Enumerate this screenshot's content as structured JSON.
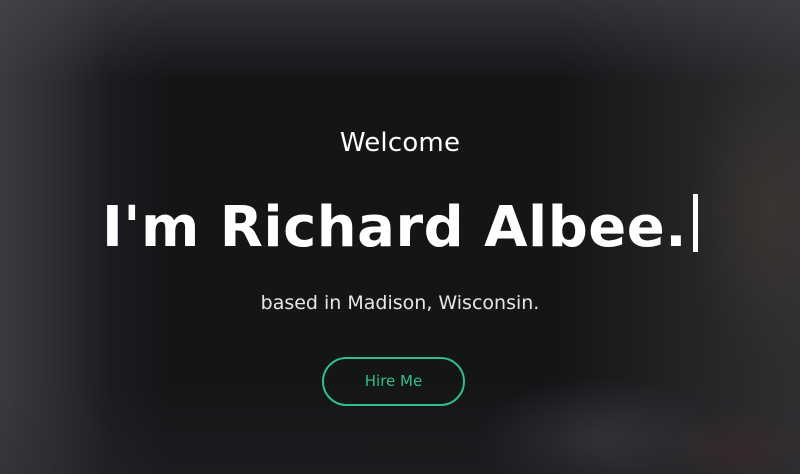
{
  "hero": {
    "welcome": "Welcome",
    "headline": "I'm Richard Albee.",
    "subtitle": "based in Madison, Wisconsin.",
    "cta_label": "Hire Me"
  },
  "colors": {
    "accent": "#2ebf8a",
    "text": "#ffffff",
    "background": "#121315"
  }
}
